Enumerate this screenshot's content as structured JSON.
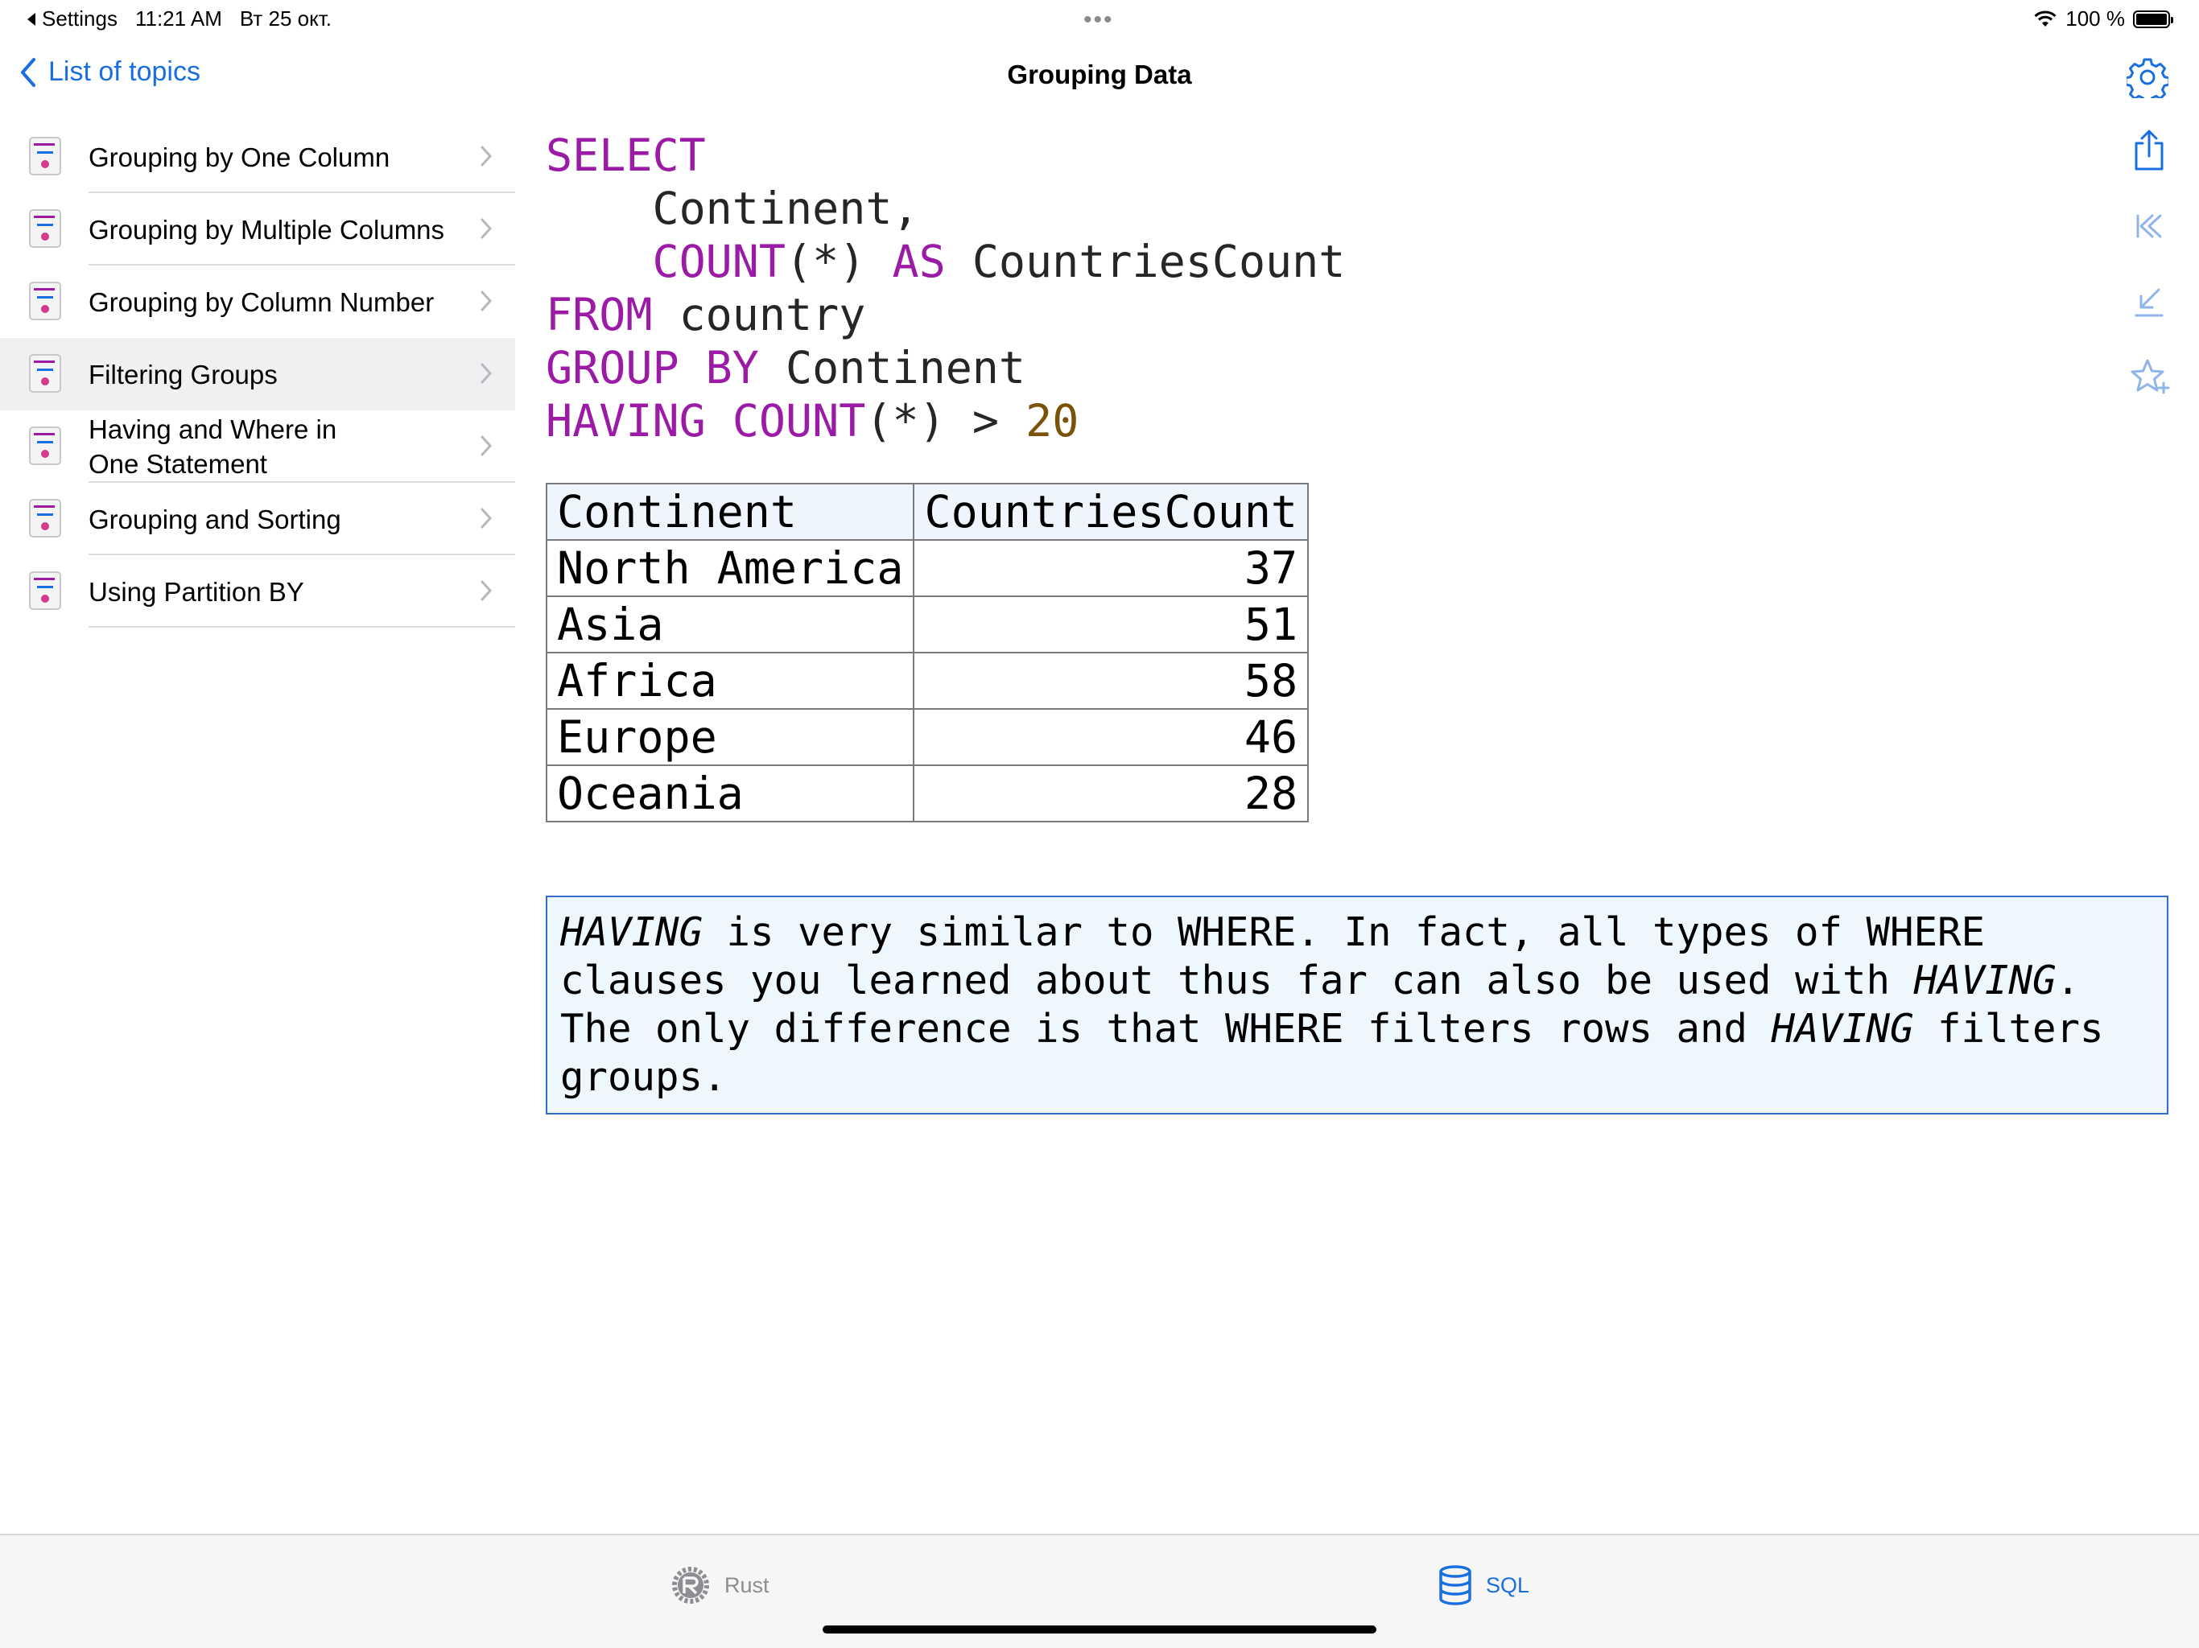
{
  "status_bar": {
    "back_app": "Settings",
    "time": "11:21 AM",
    "date": "Вт 25 окт.",
    "battery": "100 %"
  },
  "nav": {
    "back_label": "List of topics",
    "title": "Grouping Data"
  },
  "topics": [
    {
      "label": "Grouping by One Column"
    },
    {
      "label": "Grouping by Multiple Columns"
    },
    {
      "label": "Grouping by Column Number"
    },
    {
      "label": "Filtering Groups"
    },
    {
      "label_line1": "Having and Where in",
      "label_line2": "One Statement"
    },
    {
      "label": "Grouping and Sorting"
    },
    {
      "label": "Using Partition BY"
    }
  ],
  "selected_topic": "Filtering Groups",
  "code": {
    "l1_kw": "SELECT",
    "l2": "    Continent,",
    "l3_kw1": "    COUNT",
    "l3_plain": "(*) ",
    "l3_kw2": "AS",
    "l3_rest": " CountriesCount",
    "l4_kw": "FROM",
    "l4_rest": " country",
    "l5_kw": "GROUP BY",
    "l5_rest": " Continent",
    "l6_kw1": "HAVING",
    "l6_space": " ",
    "l6_kw2": "COUNT",
    "l6_plain": "(*) > ",
    "l6_num": "20"
  },
  "result": {
    "headers": [
      "Continent",
      "CountriesCount"
    ],
    "rows": [
      [
        "North America",
        "37"
      ],
      [
        "Asia",
        "51"
      ],
      [
        "Africa",
        "58"
      ],
      [
        "Europe",
        "46"
      ],
      [
        "Oceania",
        "28"
      ]
    ]
  },
  "note": {
    "p1_em": "HAVING",
    "p1": " is very similar to WHERE. In fact, all types of WHERE clauses you learned about thus far can also be used with ",
    "p2_em": "HAVING",
    "p2": ". The only difference is that WHERE filters rows and ",
    "p3_em": "HAVING",
    "p3": " filters groups."
  },
  "tabs": [
    {
      "label": "Rust",
      "icon": "rust-icon",
      "active": false
    },
    {
      "label": "SQL",
      "icon": "database-icon",
      "active": true
    }
  ],
  "colors": {
    "accent": "#1a6fe0",
    "keyword": "#9b1ba6",
    "number": "#7a5208",
    "note_bg": "#eef6fe",
    "note_border": "#2e6fc9"
  }
}
